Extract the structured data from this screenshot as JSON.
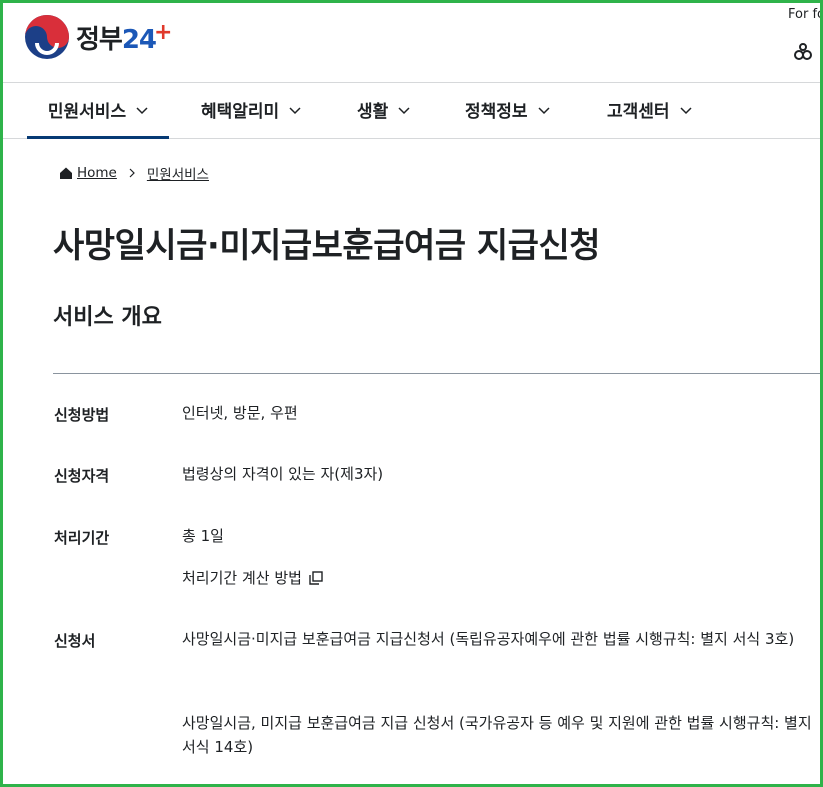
{
  "header": {
    "logo_text_a": "정부",
    "logo_text_b": "24",
    "lang": "For fo"
  },
  "nav": [
    {
      "label": "민원서비스"
    },
    {
      "label": "혜택알리미"
    },
    {
      "label": "생활"
    },
    {
      "label": "정책정보"
    },
    {
      "label": "고객센터"
    }
  ],
  "breadcrumb": [
    "Home",
    "민원서비스"
  ],
  "page": {
    "title": "사망일시금·미지급보훈급여금 지급신청",
    "section": "서비스 개요"
  },
  "overview": {
    "method_label": "신청방법",
    "method_value": "인터넷, 방문, 우편",
    "qual_label": "신청자격",
    "qual_value": "법령상의 자격이 있는 자(제3자)",
    "period_label": "처리기간",
    "period_value": "총 1일",
    "period_link": "처리기간 계산 방법",
    "form_label": "신청서",
    "form_1": "사망일시금·미지급 보훈급여금 지급신청서 (독립유공자예우에 관한 법률 시행규칙: 별지 서식 3호)",
    "form_2": "사망일시금, 미지급 보훈급여금 지급 신청서 (국가유공자 등 예우 및 지원에 관한 법률 시행규칙: 별지 서식 14호)"
  }
}
